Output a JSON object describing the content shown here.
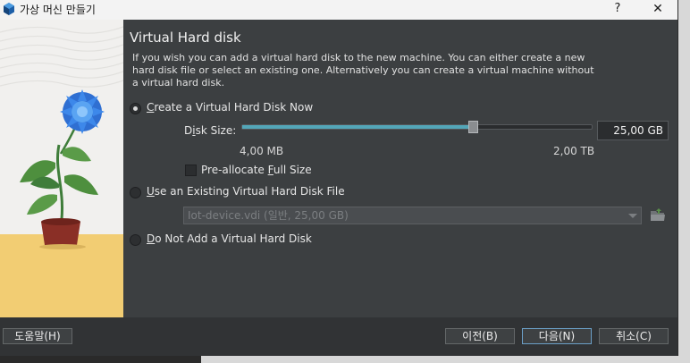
{
  "window": {
    "title": "가상 머신 만들기",
    "help": "?",
    "close": "✕"
  },
  "page": {
    "heading": "Virtual Hard disk",
    "description": "If you wish you can add a virtual hard disk to the new machine. You can either create a new hard disk file or select an existing one. Alternatively you can create a virtual machine without a virtual hard disk."
  },
  "options": {
    "create_now": {
      "pre": "",
      "key": "C",
      "post": "reate a Virtual Hard Disk Now",
      "selected": true
    },
    "use_existing": {
      "pre": "",
      "key": "U",
      "post": "se an Existing Virtual Hard Disk File",
      "selected": false
    },
    "do_not_add": {
      "pre": "",
      "key": "D",
      "post": "o Not Add a Virtual Hard Disk",
      "selected": false
    }
  },
  "disk_size": {
    "label_pre": "D",
    "label_key": "i",
    "label_post": "sk Size:",
    "value": "25,00 GB",
    "min_label": "4,00 MB",
    "max_label": "2,00 TB",
    "slider_fraction": 0.659
  },
  "preallocate": {
    "pre": "Pre-allocate ",
    "key": "F",
    "post": "ull Size",
    "checked": false
  },
  "existing_disk": {
    "value": "Iot-device.vdi (일반, 25,00 GB)"
  },
  "buttons": {
    "guide": "도움말(H)",
    "back": "이전(B)",
    "next": "다음(N)",
    "cancel": "취소(C)"
  },
  "colors": {
    "accent": "#53a6b8",
    "panel": "#3c3f41",
    "footer": "#313335",
    "art_sky": "#f1f0ee",
    "art_floor": "#f2cd73"
  },
  "icons": {
    "app": "virtualbox-icon",
    "folder": "folder-open-icon"
  }
}
